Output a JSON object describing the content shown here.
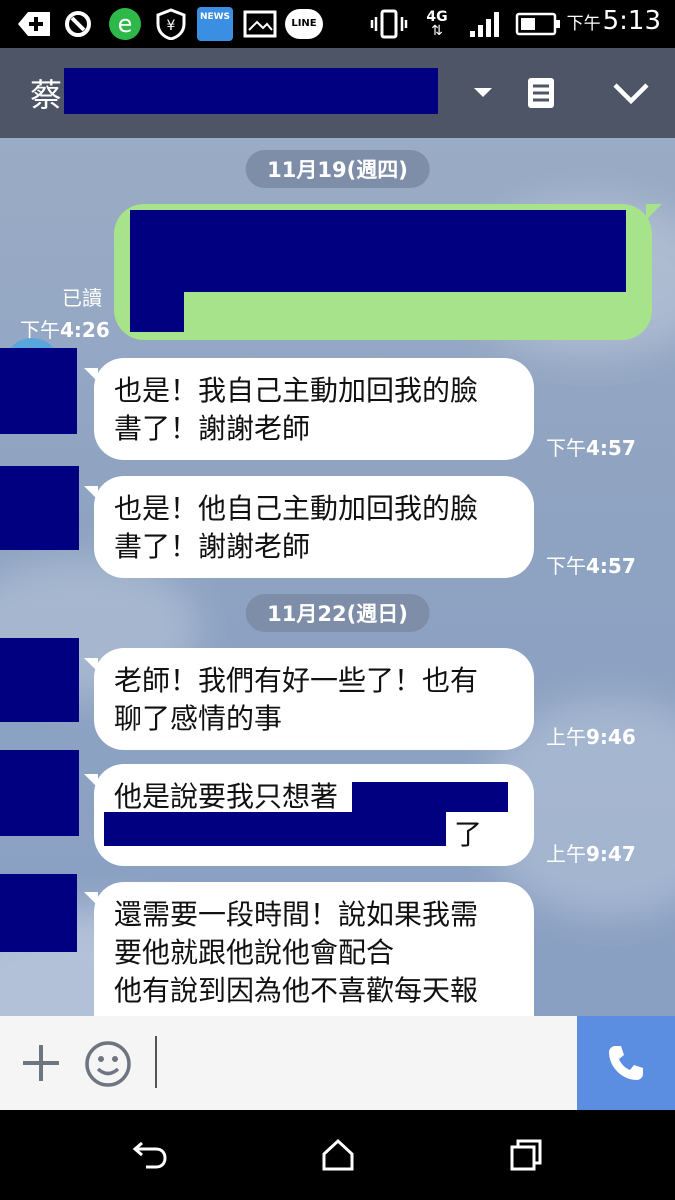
{
  "status_bar": {
    "time_prefix": "下午",
    "time": "5:13",
    "network": "4G",
    "icons": [
      "add-icon",
      "sync-icon",
      "browser-icon",
      "shield-icon",
      "news-icon",
      "gallery-icon",
      "line-icon",
      "vibrate-icon",
      "network-4g-icon",
      "signal-icon",
      "battery-icon"
    ],
    "news_label": "NEWS",
    "line_label": "LINE"
  },
  "header": {
    "contact_name": "蔡"
  },
  "chat": {
    "dates": [
      "11月19(週四)",
      "11月22(週日)"
    ],
    "outgoing": {
      "read_label": "已讀",
      "time_prefix": "下午",
      "time": "4:26"
    },
    "messages": [
      {
        "lines": [
          "也是！我自己主動加回我的臉",
          "書了！謝謝老師"
        ],
        "time_prefix": "下午",
        "time": "4:57"
      },
      {
        "lines": [
          "也是！他自己主動加回我的臉",
          "書了！謝謝老師"
        ],
        "time_prefix": "下午",
        "time": "4:57"
      },
      {
        "lines": [
          "老師！我們有好一些了！也有",
          "聊了感情的事"
        ],
        "time_prefix": "上午",
        "time": "9:46"
      },
      {
        "lines": [
          "他是說要我只想著",
          "了"
        ],
        "time_prefix": "上午",
        "time": "9:47"
      },
      {
        "lines": [
          "還需要一段時間！說如果我需",
          "要他就跟他說他會配合",
          "他有說到因為他不喜歡每天報"
        ]
      }
    ]
  },
  "colors": {
    "header_bg": "#4d5566",
    "outgoing_bubble": "#a6e38a",
    "call_button": "#5b8ee0",
    "redaction": "#000080"
  }
}
